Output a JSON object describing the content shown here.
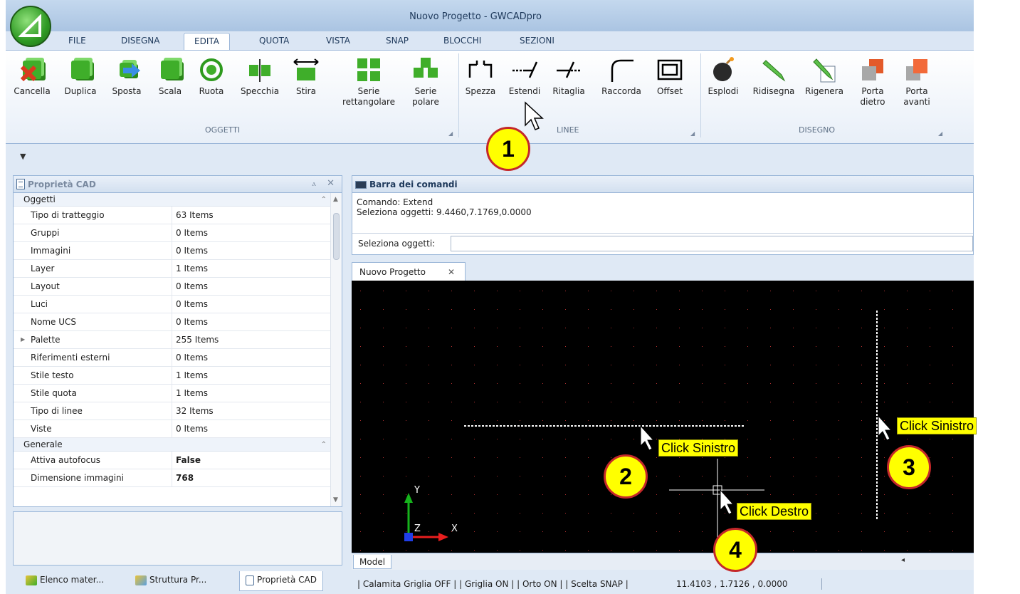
{
  "window": {
    "title": "Nuovo Progetto - GWCADpro"
  },
  "tabs": [
    {
      "label": "FILE",
      "active": false
    },
    {
      "label": "DISEGNA",
      "active": false
    },
    {
      "label": "EDITA",
      "active": true
    },
    {
      "label": "QUOTA",
      "active": false
    },
    {
      "label": "VISTA",
      "active": false
    },
    {
      "label": "SNAP",
      "active": false
    },
    {
      "label": "BLOCCHI",
      "active": false
    },
    {
      "label": "SEZIONI",
      "active": false
    }
  ],
  "ribbon": {
    "groups": [
      {
        "label": "OGGETTI",
        "buttons": [
          "Cancella",
          "Duplica",
          "Sposta",
          "Scala",
          "Ruota",
          "Specchia",
          "Stira",
          "Serie rettangolare",
          "Serie polare"
        ]
      },
      {
        "label": "LINEE",
        "buttons": [
          "Spezza",
          "Estendi",
          "Ritaglia",
          "Raccorda",
          "Offset"
        ]
      },
      {
        "label": "DISEGNO",
        "buttons": [
          "Esplodi",
          "Ridisegna",
          "Rigenera",
          "Porta dietro",
          "Porta avanti"
        ]
      }
    ],
    "serie_rett_line1": "Serie",
    "serie_rett_line2": "rettangolare",
    "serie_pol_line1": "Serie",
    "serie_pol_line2": "polare",
    "porta_dietro_line1": "Porta",
    "porta_dietro_line2": "dietro",
    "porta_avanti_line1": "Porta",
    "porta_avanti_line2": "avanti"
  },
  "properties": {
    "title": "Proprietà CAD",
    "categories": [
      {
        "name": "Oggetti",
        "rows": [
          {
            "name": "Tipo di tratteggio",
            "value": "63 Items"
          },
          {
            "name": "Gruppi",
            "value": "0 Items"
          },
          {
            "name": "Immagini",
            "value": "0 Items"
          },
          {
            "name": "Layer",
            "value": "1 Items"
          },
          {
            "name": "Layout",
            "value": "0 Items"
          },
          {
            "name": "Luci",
            "value": "0 Items"
          },
          {
            "name": "Nome UCS",
            "value": "0 Items"
          },
          {
            "name": "Palette",
            "value": "255 Items"
          },
          {
            "name": "Riferimenti esterni",
            "value": "0 Items"
          },
          {
            "name": "Stile testo",
            "value": "1 Items"
          },
          {
            "name": "Stile quota",
            "value": "1 Items"
          },
          {
            "name": "Tipo di linee",
            "value": "32 Items"
          },
          {
            "name": "Viste",
            "value": "0 Items"
          }
        ]
      },
      {
        "name": "Generale",
        "rows": [
          {
            "name": "Attiva autofocus",
            "value": "False"
          },
          {
            "name": "Dimensione immagini",
            "value": "768"
          }
        ]
      }
    ]
  },
  "bottom_tabs": [
    "Elenco mater...",
    "Struttura Pr...",
    "Proprietà CAD"
  ],
  "command_bar": {
    "title": "Barra dei comandi",
    "history": [
      "Comando: Extend",
      "Seleziona oggetti: 9.4460,7.1769,0.0000"
    ],
    "prompt_label": "Seleziona oggetti:",
    "input_value": ""
  },
  "document": {
    "tab_label": "Nuovo Progetto",
    "model_tab": "Model"
  },
  "statusbar": {
    "text": "| Calamita Griglia OFF | | Griglia ON | | Orto ON | | Scelta SNAP |",
    "coords": "11.4103 , 1.7126 , 0.0000"
  },
  "ucs": {
    "y": "Y",
    "z": "Z",
    "x": "X"
  },
  "annotations": {
    "callouts": [
      "1",
      "2",
      "3",
      "4"
    ],
    "notes": [
      "Click Sinistro",
      "Click Sinistro",
      "Click Destro"
    ]
  },
  "colors": {
    "accent": "#3fae2a",
    "callout_fill": "#ffff00",
    "callout_border": "#c4282a",
    "canvas_bg": "#000000"
  }
}
